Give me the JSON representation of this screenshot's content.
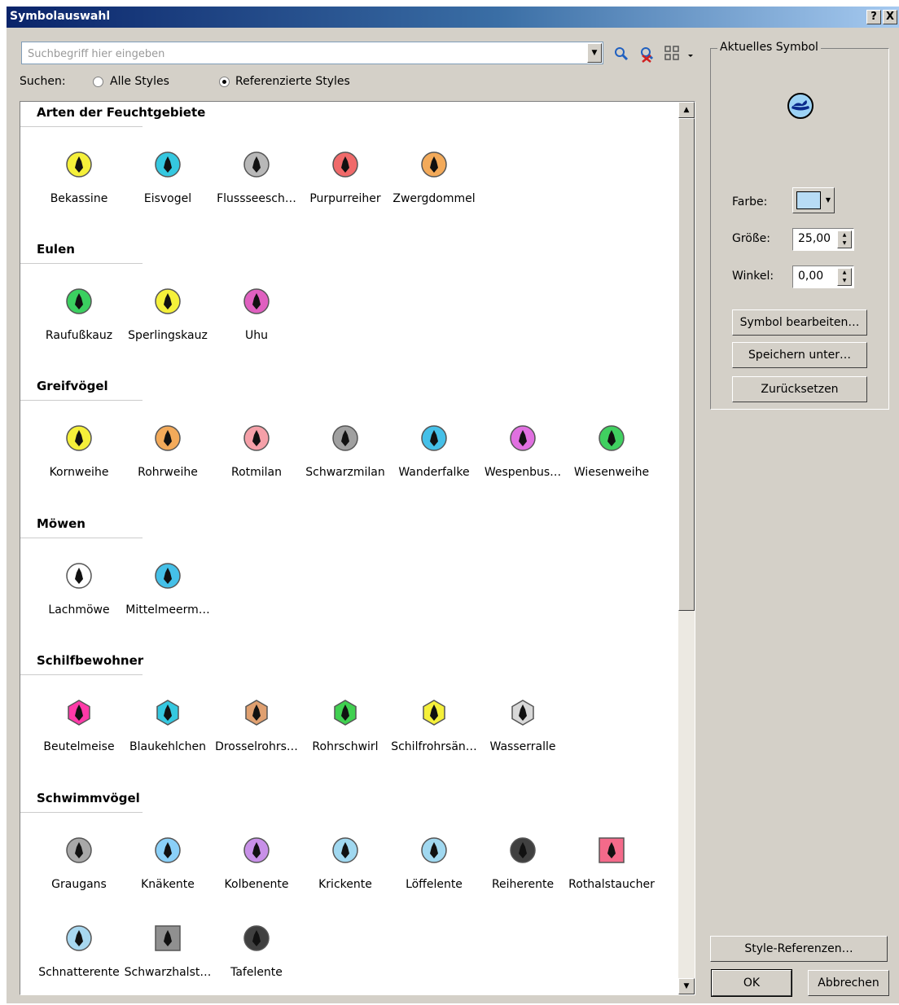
{
  "window": {
    "title": "Symbolauswahl",
    "help": "?",
    "close": "X"
  },
  "search": {
    "placeholder": "Suchbegriff hier eingeben",
    "label": "Suchen:",
    "option_all": "Alle Styles",
    "option_ref": "Referenzierte Styles",
    "selected": "Referenzierte Styles"
  },
  "groups": [
    {
      "name": "Arten der Feuchtgebiete",
      "items": [
        {
          "label": "Bekassine",
          "color": "#f5f03a",
          "shape": "circle"
        },
        {
          "label": "Eisvogel",
          "color": "#35c8e0",
          "shape": "circle"
        },
        {
          "label": "Flussseesch…",
          "color": "#b8b8b8",
          "shape": "circle"
        },
        {
          "label": "Purpurreiher",
          "color": "#f06a6a",
          "shape": "circle"
        },
        {
          "label": "Zwergdommel",
          "color": "#f3aa5a",
          "shape": "circle"
        }
      ]
    },
    {
      "name": "Eulen",
      "items": [
        {
          "label": "Raufußkauz",
          "color": "#3bd060",
          "shape": "circle"
        },
        {
          "label": "Sperlingskauz",
          "color": "#f5f03a",
          "shape": "circle"
        },
        {
          "label": "Uhu",
          "color": "#e060c0",
          "shape": "circle"
        }
      ]
    },
    {
      "name": "Greifvögel",
      "items": [
        {
          "label": "Kornweihe",
          "color": "#f5f03a",
          "shape": "circle"
        },
        {
          "label": "Rohrweihe",
          "color": "#f3aa5a",
          "shape": "circle"
        },
        {
          "label": "Rotmilan",
          "color": "#f5a0a8",
          "shape": "circle"
        },
        {
          "label": "Schwarzmilan",
          "color": "#a0a0a0",
          "shape": "circle"
        },
        {
          "label": "Wanderfalke",
          "color": "#45c0e8",
          "shape": "circle"
        },
        {
          "label": "Wespenbus…",
          "color": "#e070e0",
          "shape": "circle"
        },
        {
          "label": "Wiesenweihe",
          "color": "#40d060",
          "shape": "circle"
        }
      ]
    },
    {
      "name": "Möwen",
      "items": [
        {
          "label": "Lachmöwe",
          "color": "#ffffff",
          "shape": "circle"
        },
        {
          "label": "Mittelmeerm…",
          "color": "#45c0e8",
          "shape": "circle"
        }
      ]
    },
    {
      "name": "Schilfbewohner",
      "items": [
        {
          "label": "Beutelmeise",
          "color": "#ff3aa8",
          "shape": "hex"
        },
        {
          "label": "Blaukehlchen",
          "color": "#35c8e0",
          "shape": "hex"
        },
        {
          "label": "Drosselrohrs…",
          "color": "#e0a070",
          "shape": "hex"
        },
        {
          "label": "Rohrschwirl",
          "color": "#40d050",
          "shape": "hex"
        },
        {
          "label": "Schilfrohrsän…",
          "color": "#f5f03a",
          "shape": "hex"
        },
        {
          "label": "Wasserralle",
          "color": "#d8d8d8",
          "shape": "hex"
        }
      ]
    },
    {
      "name": "Schwimmvögel",
      "items": [
        {
          "label": "Graugans",
          "color": "#a8a8a8",
          "shape": "circle"
        },
        {
          "label": "Knäkente",
          "color": "#8ad0f8",
          "shape": "circle"
        },
        {
          "label": "Kolbenente",
          "color": "#c890e8",
          "shape": "circle"
        },
        {
          "label": "Krickente",
          "color": "#a0d8f0",
          "shape": "circle"
        },
        {
          "label": "Löffelente",
          "color": "#a0d8f0",
          "shape": "circle"
        },
        {
          "label": "Reiherente",
          "color": "#404040",
          "shape": "circle"
        },
        {
          "label": "Rothalstaucher",
          "color": "#f46a8a",
          "shape": "square"
        },
        {
          "label": "Schnatterente",
          "color": "#a8d8f0",
          "shape": "circle"
        },
        {
          "label": "Schwarzhalst…",
          "color": "#909090",
          "shape": "square"
        },
        {
          "label": "Tafelente",
          "color": "#404040",
          "shape": "circle"
        }
      ]
    }
  ],
  "current_symbol": {
    "legend": "Aktuelles Symbol",
    "preview_color": "#9cd2f5",
    "color_label": "Farbe:",
    "color_value": "#b8dcf5",
    "size_label": "Größe:",
    "size_value": "25,00",
    "angle_label": "Winkel:",
    "angle_value": "0,00",
    "edit_button": "Symbol bearbeiten…",
    "save_button": "Speichern unter…",
    "reset_button": "Zurücksetzen"
  },
  "footer": {
    "style_refs_button": "Style-Referenzen…",
    "ok_button": "OK",
    "cancel_button": "Abbrechen"
  }
}
